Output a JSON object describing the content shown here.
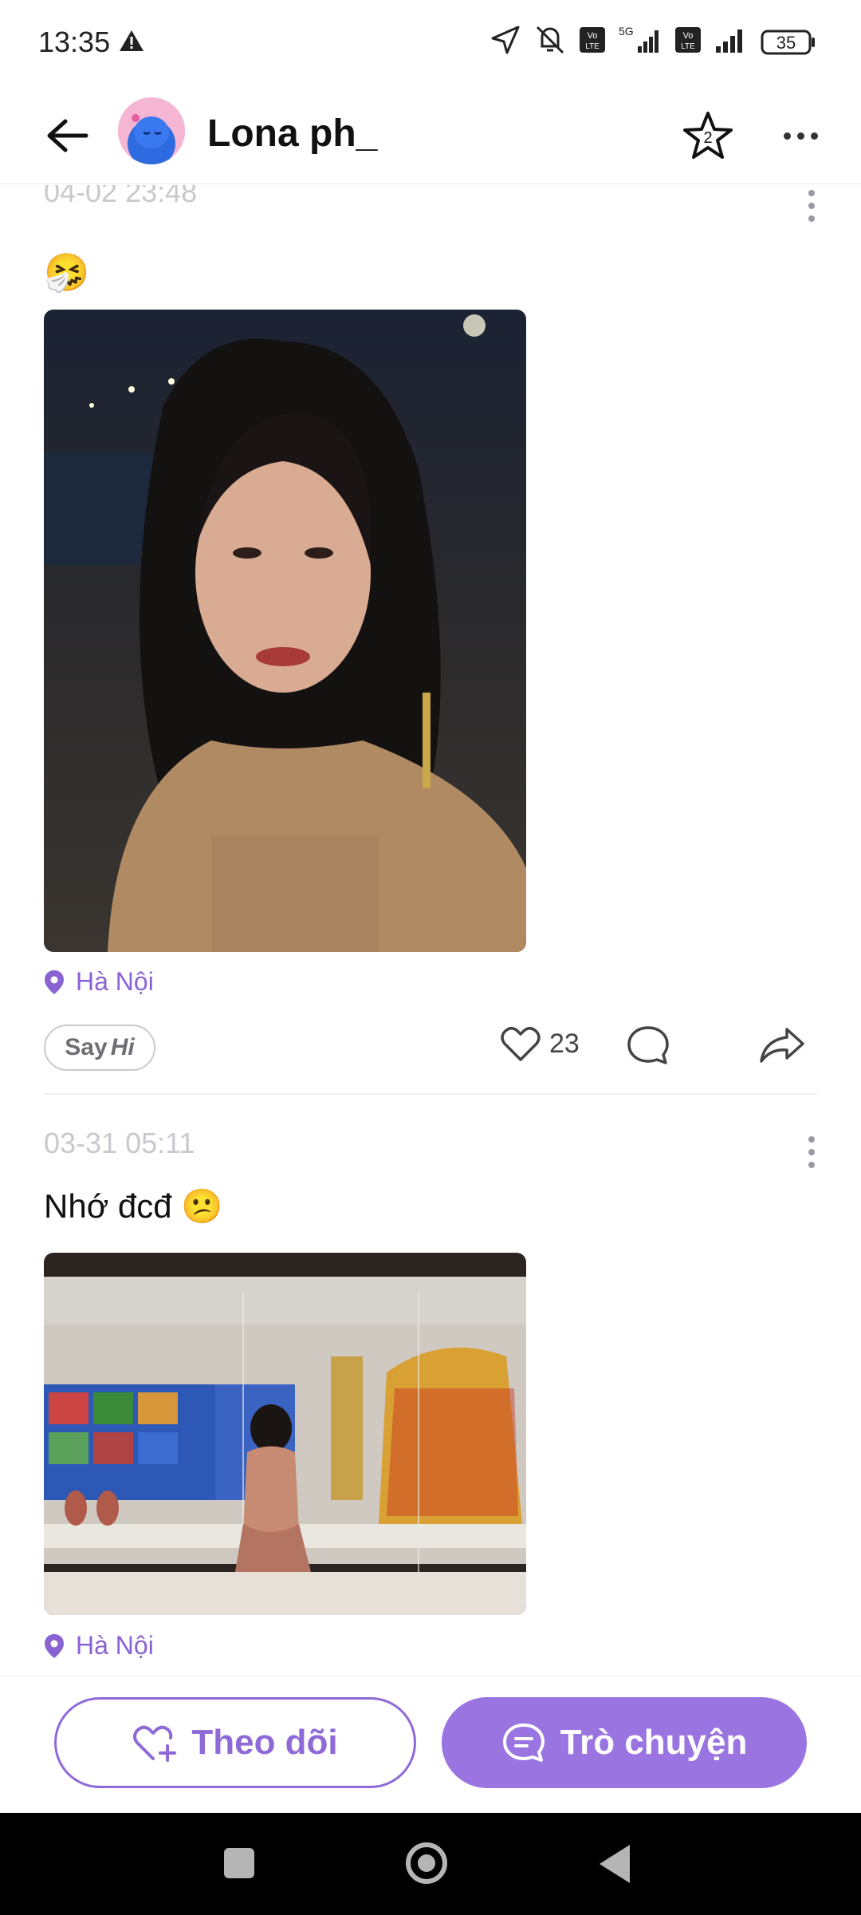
{
  "status_bar": {
    "time": "13:35",
    "battery": "35",
    "network": "5G",
    "volte": "Vo LTE"
  },
  "header": {
    "username": "Lona ph_"
  },
  "posts": [
    {
      "date": "04-02 23:48",
      "text": "🤧",
      "location": "Hà Nội",
      "sayhi_say": "Say",
      "sayhi_hi": "Hi",
      "likes": "23"
    },
    {
      "date": "03-31 05:11",
      "text": "Nhớ đcđ 😕",
      "location": "Hà Nội"
    }
  ],
  "bottom": {
    "follow_label": "Theo dõi",
    "chat_label": "Trò chuyện"
  },
  "colors": {
    "accent": "#9a74e0",
    "location": "#8a63d2"
  }
}
